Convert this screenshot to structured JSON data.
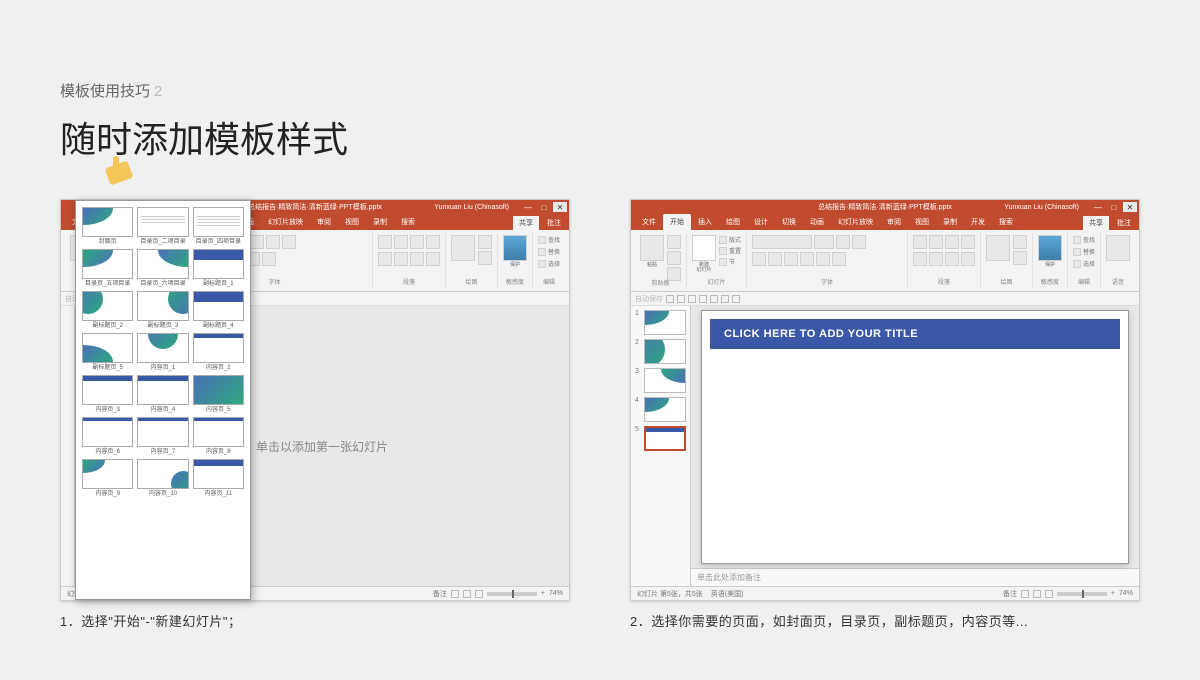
{
  "subtitle": "模板使用技巧",
  "subtitle_num": "2",
  "main_title": "随时添加模板样式",
  "doc_title": "总结报告·精致简洁·清新蓝绿·PPT模板.pptx",
  "user": "Yunxuan Liu (Chinasoft)",
  "tabs": [
    "文件",
    "开始",
    "插入",
    "绘图",
    "设计",
    "切换",
    "动画",
    "幻灯片放映",
    "审阅",
    "视图",
    "录制",
    "开发",
    "搜索"
  ],
  "active_tab": "开始",
  "share": "共享",
  "comment": "批注",
  "ribbon_groups": {
    "clipboard": {
      "label": "剪贴板",
      "main": "粘贴"
    },
    "slides": {
      "label": "幻灯片",
      "main": "新建\n幻灯片",
      "opts": [
        "版式",
        "重置",
        "节"
      ]
    },
    "font": {
      "label": "字体"
    },
    "paragraph": {
      "label": "段落"
    },
    "drawing": {
      "label": "绘图"
    },
    "sensitivity": {
      "label": "敏感度",
      "main": "保护"
    },
    "editing": {
      "label": "编辑",
      "opts": [
        "查找",
        "替换",
        "选择"
      ]
    },
    "voice": {
      "label": "语音"
    }
  },
  "layout_names": [
    "封面页",
    "目录页_二项目录",
    "目录页_四项目录",
    "目录页_五项目录",
    "目录页_六项目录",
    "副标题页_1",
    "副标题页_2",
    "副标题页_3",
    "副标题页_4",
    "副标题页_5",
    "内容页_1",
    "内容页_2",
    "内容页_3",
    "内容页_4",
    "内容页_5",
    "内容页_6",
    "内容页_7",
    "内容页_8",
    "内容页_9",
    "内容页_10",
    "内容页_11"
  ],
  "slide1_placeholder": "单击以添加第一张幻灯片",
  "slide2_title": "CLICK HERE TO ADD YOUR TITLE",
  "notes_placeholder": "单击此处添加备注",
  "status_left1": "幻灯片",
  "status_left2_full": "幻灯片 第5张，共5张",
  "status_lang": "英语(美国)",
  "status_notes": "备注",
  "zoom": "74%",
  "caption1": "1．选择\"开始\"-\"新建幻灯片\"；",
  "caption2": "2．选择你需要的页面，如封面页，目录页，副标题页，内容页等..."
}
